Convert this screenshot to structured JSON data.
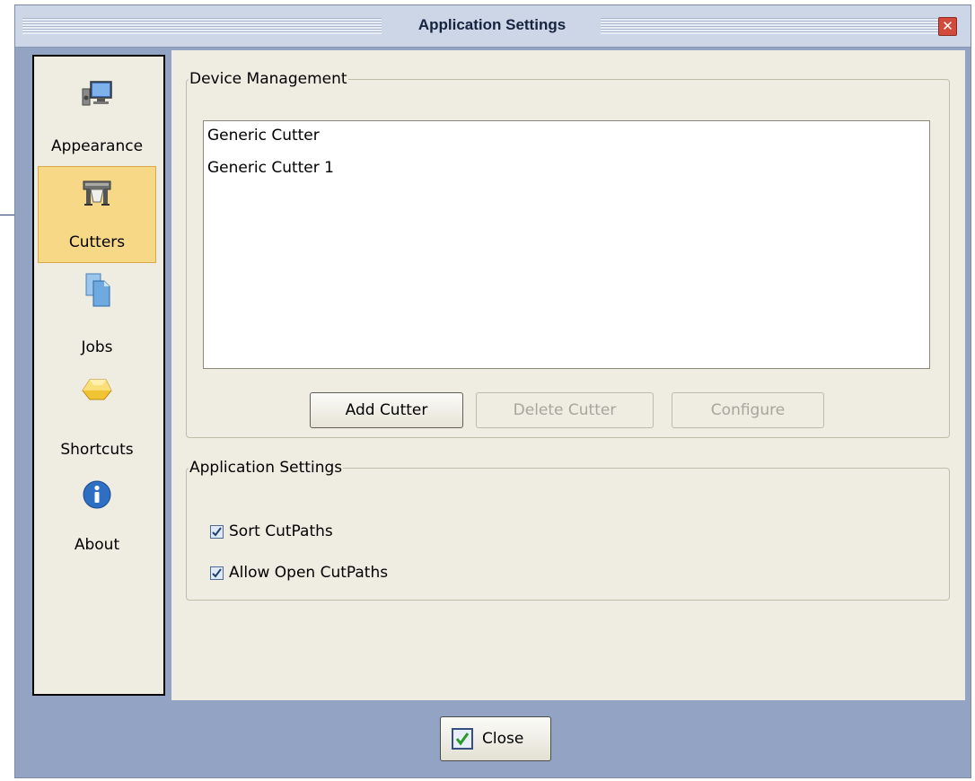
{
  "window": {
    "title": "Application Settings",
    "close_icon": "close-x-icon"
  },
  "sidebar": {
    "items": [
      {
        "label": "Appearance",
        "icon": "monitor-speaker-icon",
        "selected": false
      },
      {
        "label": "Cutters",
        "icon": "cutter-plotter-icon",
        "selected": true
      },
      {
        "label": "Jobs",
        "icon": "documents-icon",
        "selected": false
      },
      {
        "label": "Shortcuts",
        "icon": "gold-bar-icon",
        "selected": false
      },
      {
        "label": "About",
        "icon": "info-icon",
        "selected": false
      }
    ]
  },
  "device_management": {
    "legend": "Device Management",
    "devices": [
      "Generic Cutter",
      "Generic Cutter 1"
    ],
    "buttons": {
      "add": "Add Cutter",
      "delete": "Delete Cutter",
      "configure": "Configure"
    },
    "enabled": {
      "add": true,
      "delete": false,
      "configure": false
    }
  },
  "application_settings": {
    "legend": "Application Settings",
    "options": [
      {
        "label": "Sort CutPaths",
        "checked": true
      },
      {
        "label": "Allow Open CutPaths",
        "checked": true
      }
    ]
  },
  "footer": {
    "close_label": "Close",
    "close_icon": "check-icon"
  },
  "colors": {
    "titlebar": "#cdd6e6",
    "frame": "#93a3c4",
    "panel": "#efece2",
    "selected_nav": "#f6d887",
    "close_red": "#d24a3c"
  }
}
